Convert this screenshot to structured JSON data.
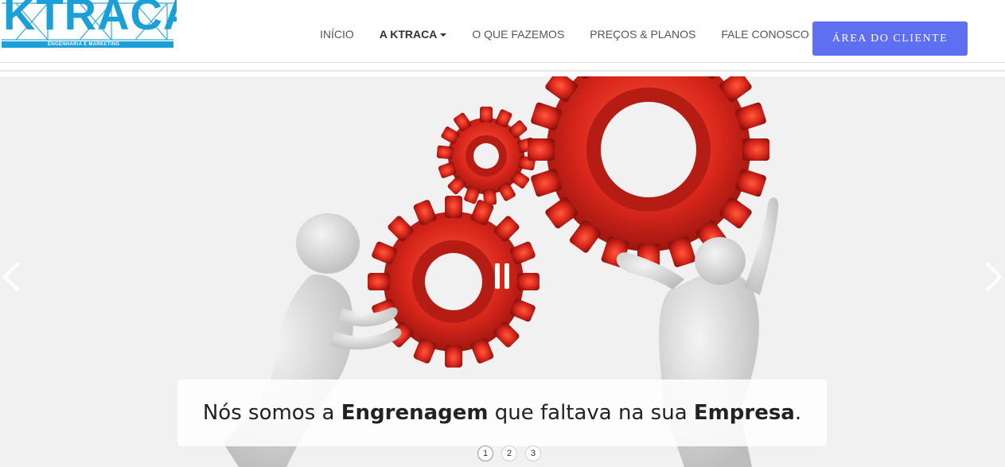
{
  "logo": {
    "text": "KTRACA",
    "subtitle": "ENGENHARIA E MARKETING",
    "color": "#1a9fd8"
  },
  "nav": {
    "items": [
      {
        "label": "INÍCIO"
      },
      {
        "label": "A KTRACA"
      },
      {
        "label": "O QUE FAZEMOS"
      },
      {
        "label": "PREÇOS & PLANOS"
      },
      {
        "label": "FALE CONOSCO"
      }
    ],
    "client_button": "ÁREA DO CLIENTE",
    "client_button_color": "#5f6ff2"
  },
  "slider": {
    "caption_part1": "Nós somos a ",
    "caption_bold1": "Engrenagem",
    "caption_part2": " que faltava na sua ",
    "caption_bold2": "Empresa",
    "caption_part3": ".",
    "pages": [
      "1",
      "2",
      "3"
    ],
    "current_page": 1,
    "prev_icon": "chevron-left-icon",
    "next_icon": "chevron-right-icon",
    "pause_icon": "pause-icon",
    "gear_color": "#d8261b"
  }
}
